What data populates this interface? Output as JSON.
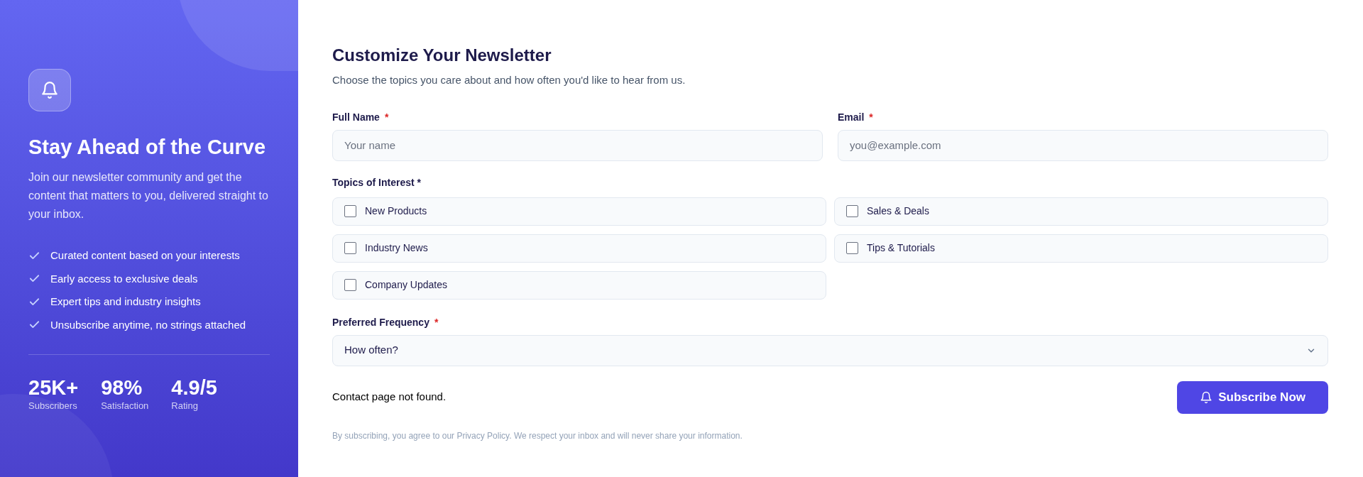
{
  "hero": {
    "title": "Stay Ahead of the Curve",
    "description": "Join our newsletter community and get the content that matters to you, delivered straight to your inbox.",
    "features": [
      "Curated content based on your interests",
      "Early access to exclusive deals",
      "Expert tips and industry insights",
      "Unsubscribe anytime, no strings attached"
    ],
    "stats": [
      {
        "value": "25K+",
        "label": "Subscribers"
      },
      {
        "value": "98%",
        "label": "Satisfaction"
      },
      {
        "value": "4.9/5",
        "label": "Rating"
      }
    ]
  },
  "form": {
    "title": "Customize Your Newsletter",
    "subtitle": "Choose the topics you care about and how often you'd like to hear from us.",
    "fields": [
      {
        "label": "Full Name",
        "required_mark": "*",
        "placeholder": "Your name"
      },
      {
        "label": "Email",
        "required_mark": "*",
        "placeholder": "you@example.com"
      }
    ],
    "topics_label": "Topics of Interest *",
    "topics": [
      {
        "label": "New Products",
        "checked": false
      },
      {
        "label": "Sales & Deals",
        "checked": false
      },
      {
        "label": "Industry News",
        "checked": false
      },
      {
        "label": "Tips & Tutorials",
        "checked": false
      },
      {
        "label": "Company Updates",
        "checked": false
      }
    ],
    "frequency": {
      "label": "Preferred Frequency",
      "required_mark": "*",
      "value": "How often?"
    },
    "message": "Contact page not found.",
    "submit": "Subscribe Now",
    "footnote": "By subscribing, you agree to our Privacy Policy. We respect your inbox and will never share your information."
  }
}
